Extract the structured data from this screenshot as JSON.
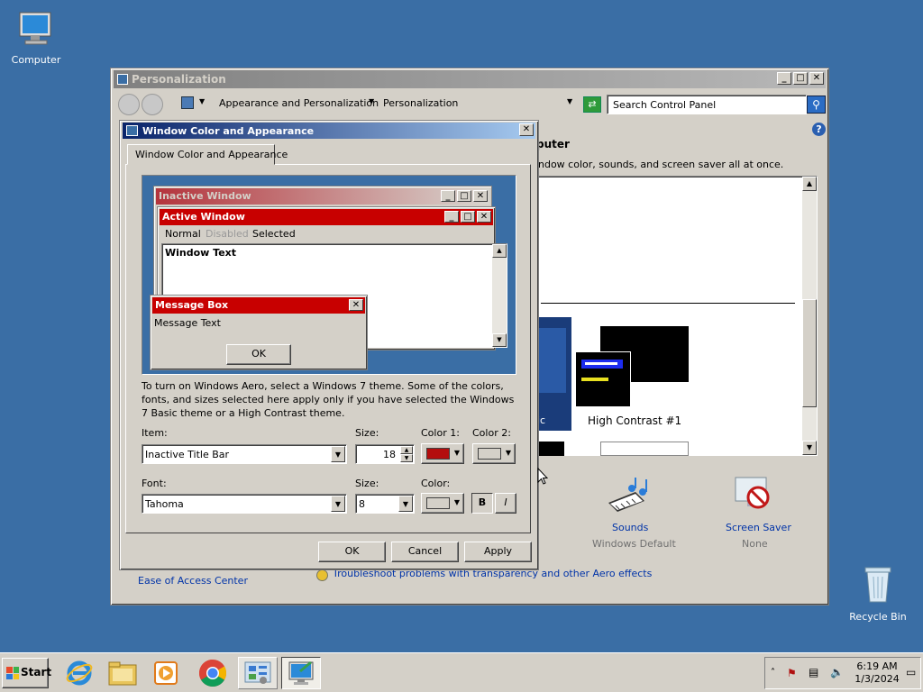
{
  "desktop": {
    "computer_label": "Computer",
    "recycle_label": "Recycle Bin"
  },
  "personalization": {
    "title": "Personalization",
    "breadcrumb": [
      "Appearance and Personalization",
      "Personalization"
    ],
    "search_placeholder": "Search Control Panel",
    "heading_fragment": "puter",
    "desc_fragment": "ndow color, sounds, and screen saver all at once.",
    "theme_fragment": "ic",
    "theme_high_contrast": "High Contrast #1",
    "sounds_label": "Sounds",
    "sounds_value": "Windows Default",
    "screensaver_label": "Screen Saver",
    "screensaver_value": "None",
    "ease_access": "Ease of Access Center",
    "troubleshoot": "Troubleshoot problems with transparency and other Aero effects"
  },
  "dialog": {
    "title": "Window Color and Appearance",
    "tab": "Window Color and Appearance",
    "preview": {
      "inactive": "Inactive Window",
      "active": "Active Window",
      "menu_normal": "Normal",
      "menu_disabled": "Disabled",
      "menu_selected": "Selected",
      "window_text": "Window Text",
      "msgbox_title": "Message Box",
      "msgbox_text": "Message Text",
      "msgbox_ok": "OK"
    },
    "info": "To turn on Windows Aero, select a Windows 7 theme.  Some of the colors, fonts, and sizes selected here apply only if you have selected the Windows 7 Basic theme or a High Contrast theme.",
    "item_label": "Item:",
    "item_value": "Inactive Title Bar",
    "size_label": "Size:",
    "size_value": "18",
    "color1_label": "Color 1:",
    "color2_label": "Color 2:",
    "font_label": "Font:",
    "font_value": "Tahoma",
    "font_size_label": "Size:",
    "font_size_value": "8",
    "font_color_label": "Color:",
    "bold": "B",
    "italic": "I",
    "ok": "OK",
    "cancel": "Cancel",
    "apply": "Apply",
    "colors": {
      "color1": "#b40e0e",
      "color2": "#d4d0c8",
      "font_color": "#d4d0c8",
      "active_title": "#c80000",
      "inactive_title": "#b4343c"
    }
  },
  "taskbar": {
    "start": "Start",
    "time": "6:19 AM",
    "date": "1/3/2024"
  }
}
